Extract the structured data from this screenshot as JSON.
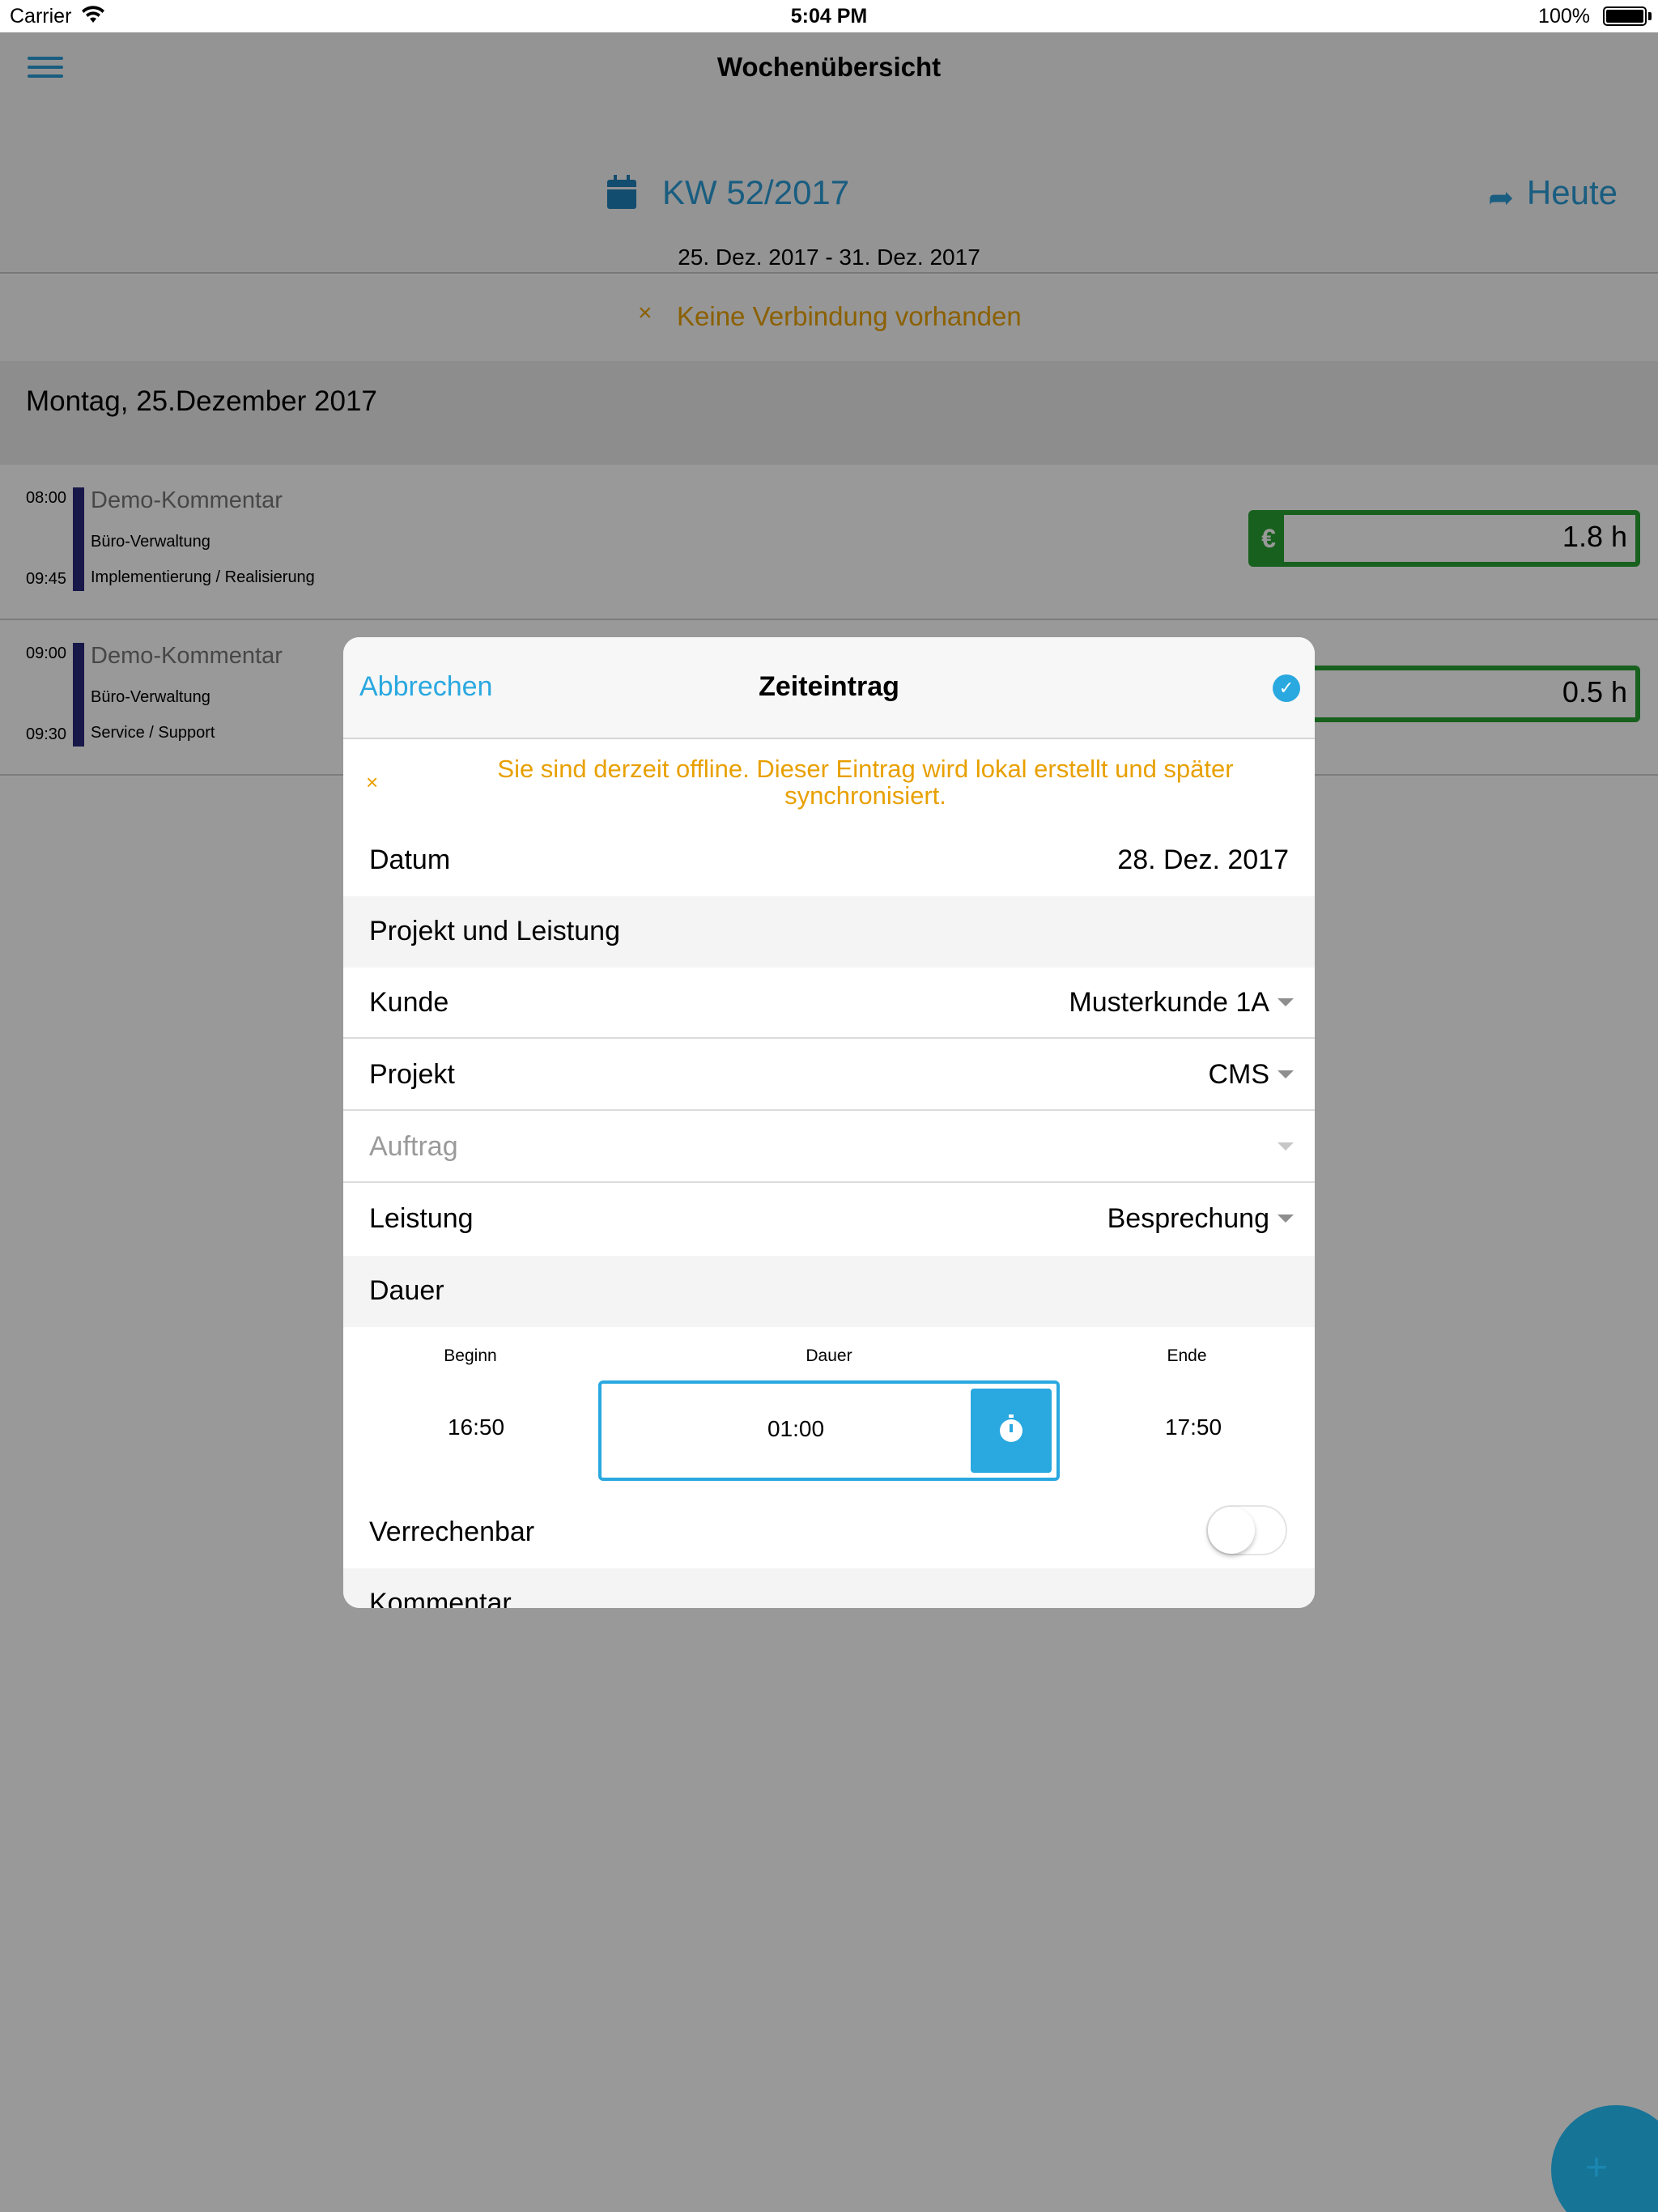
{
  "status_bar": {
    "carrier": "Carrier",
    "time": "5:04 PM",
    "battery": "100%"
  },
  "navbar": {
    "title": "Wochenübersicht",
    "menu_icon": "hamburger-menu-icon"
  },
  "week": {
    "label": "KW 52/2017",
    "range": "25. Dez. 2017 - 31. Dez. 2017",
    "today": "Heute",
    "calendar_icon": "calendar-icon",
    "today_icon": "share-arrow-icon"
  },
  "offline_banner": {
    "icon": "close-icon",
    "text": "Keine Verbindung vorhanden"
  },
  "day_header": "Montag, 25.Dezember 2017",
  "entries": [
    {
      "start": "08:00",
      "end": "09:45",
      "comment": "Demo-Kommentar",
      "line1": "Büro-Verwaltung",
      "line2": "Implementierung / Realisierung",
      "hours": "1.8 h",
      "currency": "€"
    },
    {
      "start": "09:00",
      "end": "09:30",
      "comment": "Demo-Kommentar",
      "line1": "Büro-Verwaltung",
      "line2": "Service / Support",
      "hours": "0.5 h",
      "currency": "€"
    }
  ],
  "modal": {
    "cancel": "Abbrechen",
    "title": "Zeiteintrag",
    "save_icon": "checkmark-circle-icon",
    "offline_note": "Sie sind derzeit offline. Dieser Eintrag wird lokal erstellt und später synchronisiert.",
    "date_label": "Datum",
    "date_value": "28. Dez. 2017",
    "section_project": "Projekt und Leistung",
    "customer_label": "Kunde",
    "customer_value": "Musterkunde 1A",
    "project_label": "Projekt",
    "project_value": "CMS",
    "order_label": "Auftrag",
    "order_value": "",
    "service_label": "Leistung",
    "service_value": "Besprechung",
    "section_duration": "Dauer",
    "begin_head": "Beginn",
    "duration_head": "Dauer",
    "end_head": "Ende",
    "begin_value": "16:50",
    "duration_value": "01:00",
    "end_value": "17:50",
    "stopwatch_icon": "stopwatch-icon",
    "billable_label": "Verrechenbar",
    "billable_on": false,
    "section_comment": "Kommentar"
  },
  "fab": {
    "icon": "plus-icon",
    "label": "+"
  },
  "colors": {
    "accent": "#2aa8e0",
    "warning": "#e8a000",
    "billable_green": "#27a131",
    "entry_bar": "#27277a"
  }
}
